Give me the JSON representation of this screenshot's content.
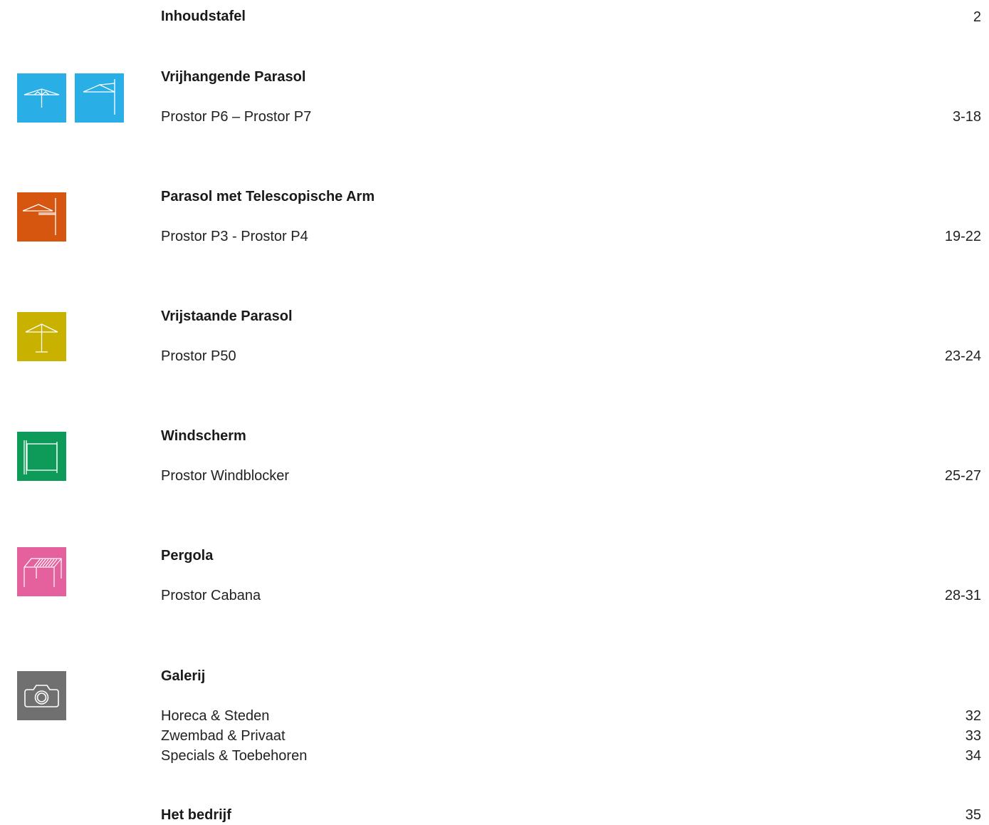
{
  "toc": {
    "title": "Inhoudstafel",
    "title_page": "2",
    "sections": [
      {
        "heading": "Vrijhangende Parasol",
        "entries": [
          {
            "label": "Prostor P6 – Prostor P7",
            "page": "3-18"
          }
        ],
        "icons": [
          "center-pole-parasol-icon",
          "cantilever-parasol-icon"
        ],
        "color": "#2aaee6"
      },
      {
        "heading": "Parasol met Telescopische Arm",
        "entries": [
          {
            "label": "Prostor P3 - Prostor P4",
            "page": "19-22"
          }
        ],
        "icons": [
          "telescopic-arm-parasol-icon"
        ],
        "color": "#d6560f"
      },
      {
        "heading": "Vrijstaande Parasol",
        "entries": [
          {
            "label": "Prostor P50",
            "page": "23-24"
          }
        ],
        "icons": [
          "freestanding-parasol-icon"
        ],
        "color": "#c9b100"
      },
      {
        "heading": "Windscherm",
        "entries": [
          {
            "label": "Prostor Windblocker",
            "page": "25-27"
          }
        ],
        "icons": [
          "windscreen-icon"
        ],
        "color": "#0e9a59"
      },
      {
        "heading": "Pergola",
        "entries": [
          {
            "label": "Prostor Cabana",
            "page": "28-31"
          }
        ],
        "icons": [
          "pergola-icon"
        ],
        "color": "#e4619d"
      },
      {
        "heading": "Galerij",
        "entries": [
          {
            "label": "Horeca & Steden",
            "page": "32"
          },
          {
            "label": "Zwembad & Privaat",
            "page": "33"
          },
          {
            "label": "Specials & Toebehoren",
            "page": "34"
          }
        ],
        "icons": [
          "camera-icon"
        ],
        "color": "#707070"
      }
    ],
    "footer": {
      "heading": "Het bedrijf",
      "page": "35"
    }
  }
}
